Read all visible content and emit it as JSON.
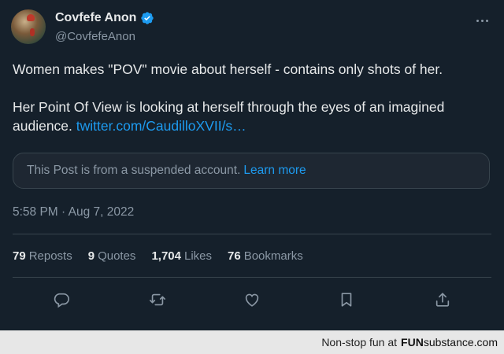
{
  "author": {
    "name": "Covfefe Anon",
    "handle": "@CovfefeAnon",
    "verified": true,
    "verified_color": "#1d9bf0"
  },
  "tweet": {
    "line1": "Women makes \"POV\" movie about herself - contains only shots of her.",
    "line2": "Her Point Of View is looking at herself through the eyes of an imagined audience.",
    "link": "twitter.com/CaudilloXVII/s…"
  },
  "quoted": {
    "message": "This Post is from a suspended account.",
    "learn_more": "Learn more"
  },
  "timestamp": "5:58 PM · Aug 7, 2022",
  "stats": {
    "reposts": {
      "count": "79",
      "label": "Reposts"
    },
    "quotes": {
      "count": "9",
      "label": "Quotes"
    },
    "likes": {
      "count": "1,704",
      "label": "Likes"
    },
    "bookmarks": {
      "count": "76",
      "label": "Bookmarks"
    }
  },
  "actions": [
    "reply-icon",
    "repost-icon",
    "like-icon",
    "bookmark-icon",
    "share-icon"
  ],
  "footer": {
    "prefix": "Non-stop fun at",
    "brand_fun": "FUN",
    "brand_rest": "substance",
    "brand_domain": ".com"
  },
  "colors": {
    "background": "#15202b",
    "text": "#e7e9ea",
    "muted": "#8b98a5",
    "accent": "#1d9bf0",
    "border": "#38444d"
  }
}
